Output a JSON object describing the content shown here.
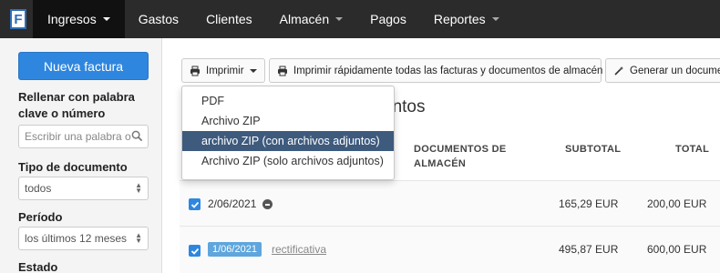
{
  "nav": {
    "logo_letter": "F",
    "items": [
      {
        "label": "Ingresos",
        "caret": true
      },
      {
        "label": "Gastos",
        "caret": false
      },
      {
        "label": "Clientes",
        "caret": false
      },
      {
        "label": "Almacén",
        "caret": true
      },
      {
        "label": "Pagos",
        "caret": false
      },
      {
        "label": "Reportes",
        "caret": true
      }
    ]
  },
  "sidebar": {
    "new_invoice": "Nueva factura",
    "fill_label_1": "Rellenar con palabra",
    "fill_label_2": "clave o número",
    "search_placeholder": "Escribir una palabra o",
    "doc_type_label": "Tipo de documento",
    "doc_type_value": "todos",
    "period_label": "Período",
    "period_value": "los últimos 12 meses",
    "status_label": "Estado"
  },
  "toolbar": {
    "print": "Imprimir",
    "print_all": "Imprimir rápidamente todas las facturas y documentos de almacén",
    "generate": "Generar un documen"
  },
  "main": {
    "heading_fragment": "entos"
  },
  "table": {
    "headers": {
      "docs_line1": "DOCUMENTOS DE",
      "docs_line2": "ALMACÉN",
      "subtotal": "SUBTOTAL",
      "total": "TOTAL"
    },
    "rows": [
      {
        "date": "2/06/2021",
        "subtotal": "165,29 EUR",
        "total": "200,00 EUR"
      },
      {
        "date": "1/06/2021",
        "tag": "rectificativa",
        "subtotal": "495,87 EUR",
        "total": "600,00 EUR"
      }
    ]
  },
  "print_menu": {
    "items": [
      "PDF",
      "Archivo ZIP",
      "archivo ZIP (con archivos adjuntos)",
      "Archivo ZIP (solo archivos adjuntos)"
    ],
    "selected_index": 2
  },
  "colors": {
    "accent": "#2f86de",
    "nav_bg": "#2b2b2b",
    "menu_selected": "#3e5a7d"
  }
}
